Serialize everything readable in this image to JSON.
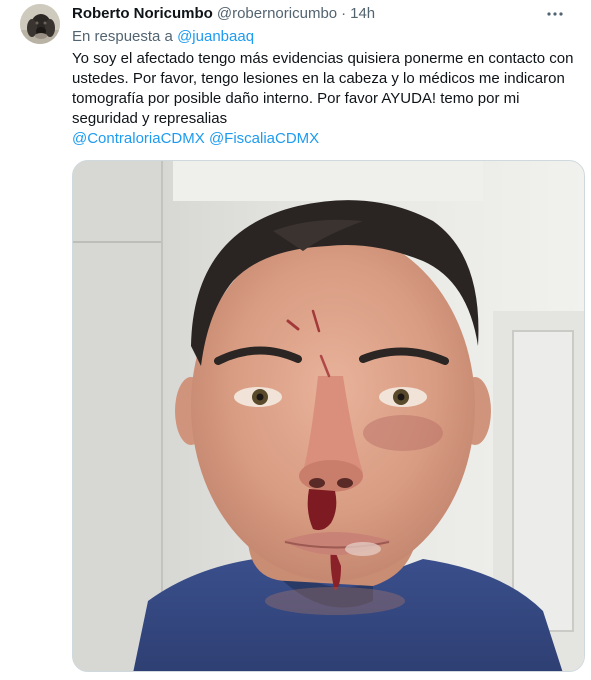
{
  "tweet": {
    "author": {
      "display_name": "Roberto Noricumbo",
      "handle": "@robernoricumbo",
      "avatar_icon": "dog-avatar-icon"
    },
    "time_separator": "·",
    "time": "14h",
    "more_icon": "more-horizontal-icon",
    "reply_prefix": "En respuesta a",
    "reply_to": "@juanbaaq",
    "text": "Yo soy el afectado tengo más evidencias quisiera ponerme en contacto con ustedes. Por favor, tengo lesiones en la cabeza y lo médicos me indicaron tomografía por posible daño interno. Por favor AYUDA! temo por mi seguridad y represalias",
    "mentions": [
      "@ContraloriaCDMX",
      "@FiscaliaCDMX"
    ],
    "media": {
      "type": "photo"
    }
  },
  "colors": {
    "text_primary": "#0f1419",
    "text_secondary": "#536471",
    "link": "#1d9bf0",
    "border": "#cfd9de"
  }
}
